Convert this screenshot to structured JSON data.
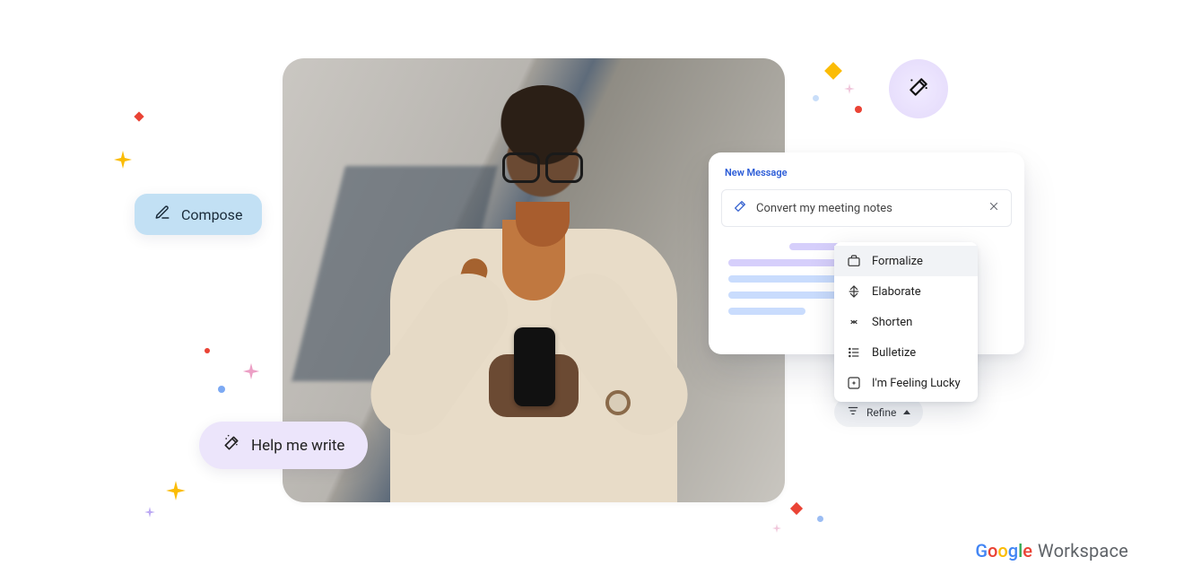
{
  "compose": {
    "label": "Compose"
  },
  "help": {
    "label": "Help me write"
  },
  "panel": {
    "title": "New Message",
    "prompt": "Convert my meeting notes"
  },
  "menu": {
    "items": [
      {
        "label": "Formalize"
      },
      {
        "label": "Elaborate"
      },
      {
        "label": "Shorten"
      },
      {
        "label": "Bulletize"
      },
      {
        "label": "I'm Feeling Lucky"
      }
    ]
  },
  "refine": {
    "label": "Refine"
  },
  "brand": {
    "g": "G",
    "o1": "o",
    "o2": "o",
    "g2": "g",
    "l": "l",
    "e": "e",
    "workspace": "Workspace"
  }
}
